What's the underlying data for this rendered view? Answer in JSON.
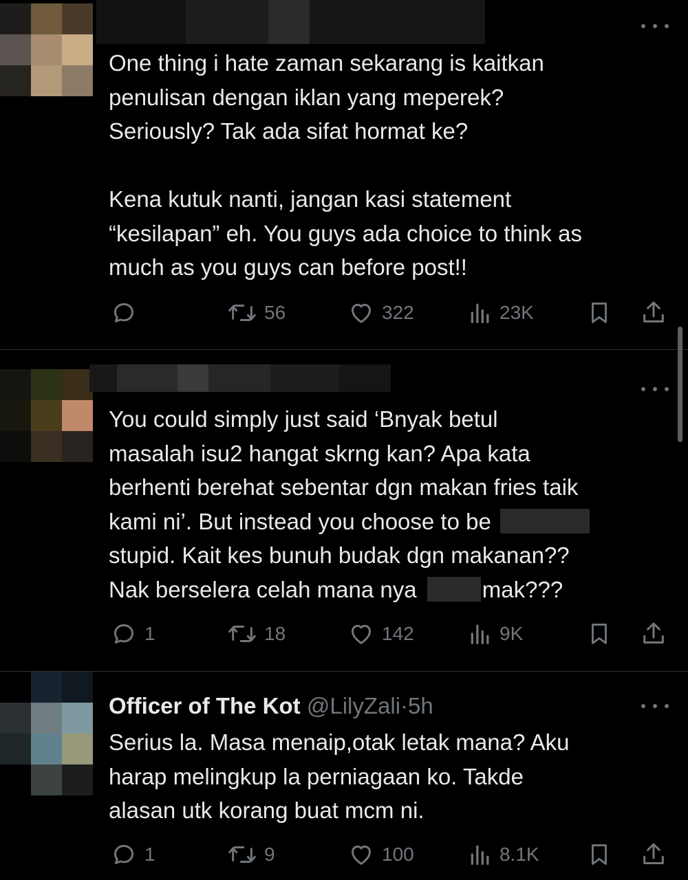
{
  "tweets": [
    {
      "display_name": "",
      "handle": "",
      "time": "",
      "lines": [
        "One thing i hate zaman sekarang is kaitkan",
        "penulisan dengan iklan yang meperek?",
        "Seriously? Tak ada sifat hormat ke?",
        "",
        "Kena kutuk nanti, jangan kasi statement",
        "“kesilapan” eh. You guys ada choice to think as",
        "much as you guys can before post!!"
      ],
      "replies": "",
      "reposts": "56",
      "likes": "322",
      "views": "23K"
    },
    {
      "display_name": "",
      "handle": "",
      "time": "",
      "lines": [
        "You could simply just said ‘Bnyak betul",
        "masalah isu2 hangat skrng kan? Apa kata",
        "berhenti berehat sebentar dgn makan fries taik",
        "kami ni’. But instead you choose to be",
        "stupid. Kait kes bunuh budak dgn makanan??",
        "Nak berselera celah mana nya",
        "mak???"
      ],
      "replies": "1",
      "reposts": "18",
      "likes": "142",
      "views": "9K"
    },
    {
      "display_name": "Officer of The Kot",
      "handle": "@LilyZali",
      "separator": "·",
      "time": "5h",
      "lines": [
        "Serius la. Masa menaip,otak letak mana? Aku",
        "harap melingkup la perniagaan ko. Takde",
        "alasan utk korang buat mcm ni."
      ],
      "replies": "1",
      "reposts": "9",
      "likes": "100",
      "views": "8.1K"
    }
  ],
  "icons": {
    "more": "more-horizontal-icon",
    "reply": "reply-icon",
    "repost": "repost-icon",
    "like": "heart-icon",
    "views": "views-icon",
    "bookmark": "bookmark-icon",
    "share": "share-icon"
  },
  "colors": {
    "background": "#000000",
    "text": "#e7e9ea",
    "secondary": "#71767b",
    "divider": "#2f3336"
  }
}
